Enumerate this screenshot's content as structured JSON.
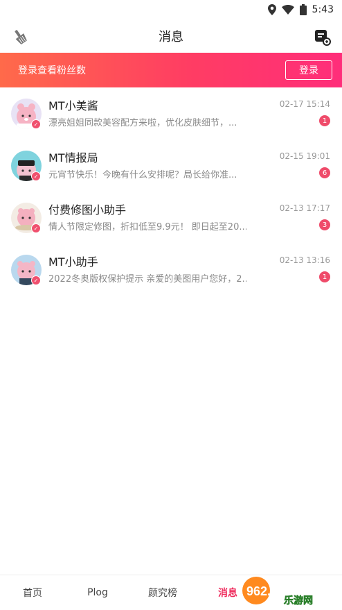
{
  "status_bar": {
    "time": "5:43"
  },
  "header": {
    "title": "消息"
  },
  "login_banner": {
    "text": "登录查看粉丝数",
    "button_label": "登录"
  },
  "messages": [
    {
      "name": "MT小美酱",
      "preview": "漂亮姐姐同款美容配方来啦，优化皮肤细节，...",
      "time": "02-17 15:14",
      "count": "1"
    },
    {
      "name": "MT情报局",
      "preview": "元宵节快乐！今晚有什么安排呢？局长给你准...",
      "time": "02-15 19:01",
      "count": "6"
    },
    {
      "name": "付费修图小助手",
      "preview": "情人节限定修图，折扣低至9.9元！ 即日起至20...",
      "time": "02-13 17:17",
      "count": "3"
    },
    {
      "name": "MT小助手",
      "preview": "2022冬奥版权保护提示 亲爱的美图用户您好，2...",
      "time": "02-13 13:16",
      "count": "1"
    }
  ],
  "tabs": [
    {
      "label": "首页"
    },
    {
      "label": "Plog"
    },
    {
      "label": "颜究榜"
    },
    {
      "label": "消息"
    }
  ],
  "watermark": {
    "text_top": "962.NET",
    "text_bottom": "乐游网"
  },
  "colors": {
    "accent": "#ef2d5e",
    "badge": "#ef4b6a",
    "banner_start": "#ff6a4a",
    "banner_end": "#ff2d7a"
  }
}
